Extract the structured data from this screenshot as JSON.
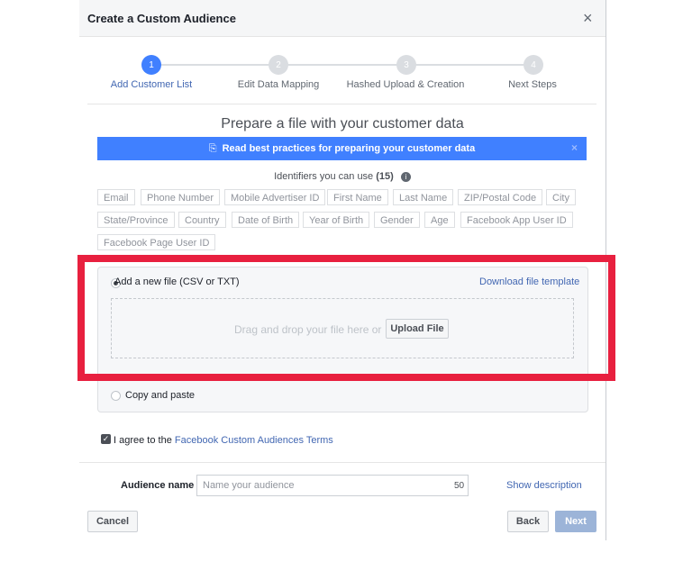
{
  "dialog": {
    "title": "Create a Custom Audience",
    "close_icon": "×"
  },
  "steps": [
    {
      "number": "1",
      "label": "Add Customer List",
      "active": true
    },
    {
      "number": "2",
      "label": "Edit Data Mapping",
      "active": false
    },
    {
      "number": "3",
      "label": "Hashed Upload & Creation",
      "active": false
    },
    {
      "number": "4",
      "label": "Next Steps",
      "active": false
    }
  ],
  "section": {
    "title": "Prepare a file with your customer data",
    "banner": {
      "icon": "⎘",
      "text": "Read best practices for preparing your customer data",
      "close": "×"
    },
    "identifiers_label": "Identifiers you can use",
    "identifiers_count": "(15)",
    "info_icon": "i"
  },
  "identifiers": [
    "Email",
    "Phone Number",
    "Mobile Advertiser ID",
    "First Name",
    "Last Name",
    "ZIP/Postal Code",
    "City",
    "State/Province",
    "Country",
    "Date of Birth",
    "Year of Birth",
    "Gender",
    "Age",
    "Facebook App User ID",
    "Facebook Page User ID"
  ],
  "upload": {
    "option_label": "Add a new file (CSV or TXT)",
    "download_link": "Download file template",
    "drop_text": "Drag and drop your file here or",
    "upload_button": "Upload File",
    "copy_option": "Copy and paste"
  },
  "terms": {
    "checkmark": "✓",
    "prefix": "I agree to the ",
    "link": "Facebook Custom Audiences Terms"
  },
  "audience": {
    "label": "Audience name",
    "placeholder": "Name your audience",
    "char_count": "50",
    "show_description": "Show description"
  },
  "footer": {
    "cancel": "Cancel",
    "back": "Back",
    "next": "Next"
  },
  "colors": {
    "accent": "#4080ff",
    "highlight": "#e8203f",
    "link": "#4267b2"
  }
}
